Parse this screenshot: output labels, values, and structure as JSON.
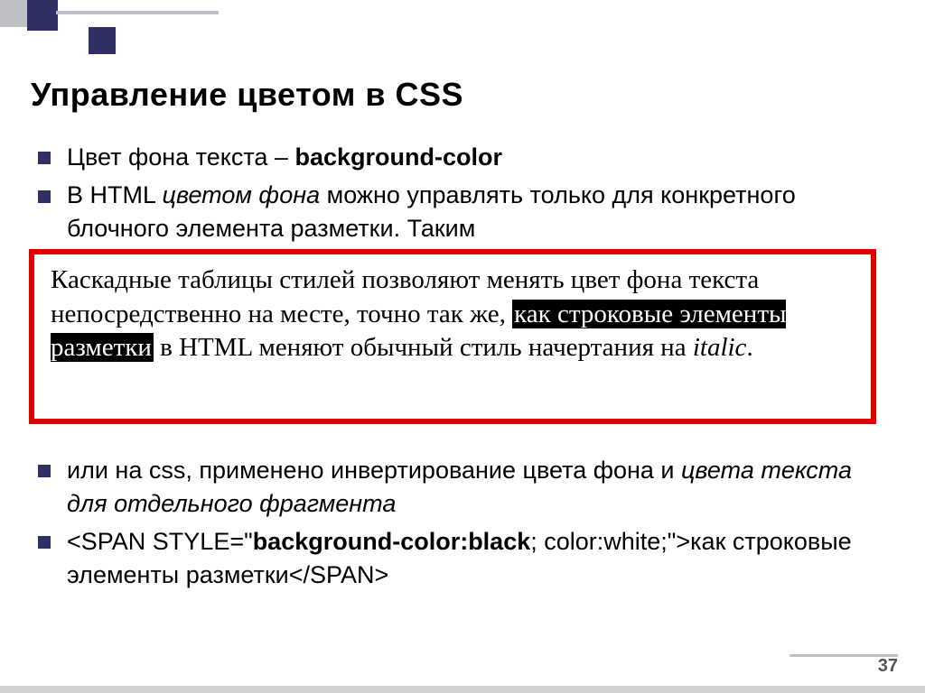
{
  "title": "Управление цветом в CSS",
  "bullets": {
    "b1_prefix": "Цвет фона текста – ",
    "b1_bold": "background-color",
    "b2_a": "В HTML ",
    "b2_i": "цветом фона",
    "b2_b": " можно управлять только для конкретного блочного элемента разметки. Таким",
    "b3_a": "или на css, применено инвертирование цвета фона и ",
    "b3_i": "цвета текста для отдельного фрагмента",
    "b4_a": "<SPAN STYLE=\"",
    "b4_bold": "background-color:black",
    "b4_b": "; color:white;\">как строковые элементы разметки</SPAN>"
  },
  "example": {
    "line1": "Каскадные таблицы стилей позволяют менять цвет фона текста непосредственно на месте, точно так же, ",
    "inv": "как строковые элементы разметки",
    "line2a": " в HTML меняют обычный стиль начертания на ",
    "italic": "italic",
    "period": "."
  },
  "page_number": "37"
}
